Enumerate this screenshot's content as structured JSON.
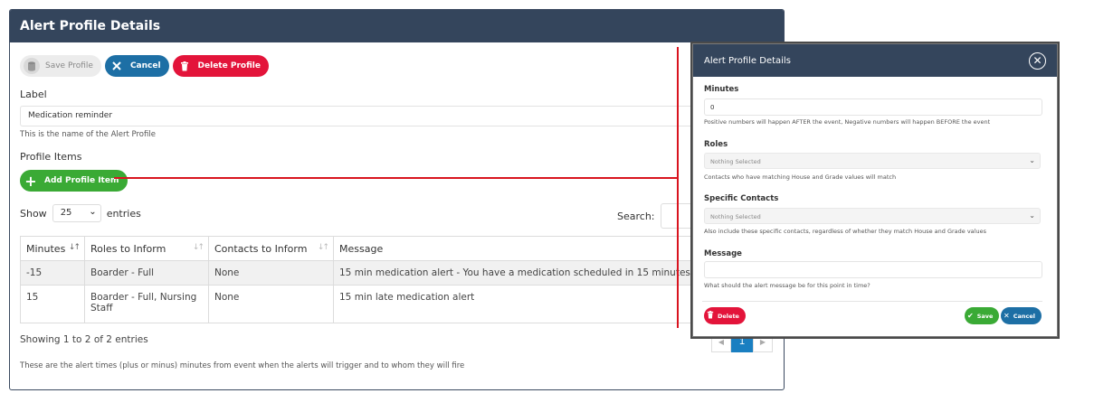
{
  "panel": {
    "title": "Alert Profile Details",
    "toolbar": {
      "save_label": "Save Profile",
      "cancel_label": "Cancel",
      "delete_label": "Delete Profile"
    },
    "label_field": {
      "label": "Label",
      "value": "Medication reminder",
      "hint": "This is the name of the Alert Profile"
    },
    "profile_items": {
      "heading": "Profile Items",
      "add_label": "Add Profile Item"
    },
    "entries": {
      "show": "Show",
      "value": "25",
      "suffix": "entries",
      "search_label": "Search:"
    },
    "table": {
      "headers": [
        "Minutes",
        "Roles to Inform",
        "Contacts to Inform",
        "Message"
      ],
      "rows": [
        [
          "-15",
          "Boarder - Full",
          "None",
          "15 min medication alert - You have a medication scheduled in 15 minutes"
        ],
        [
          "15",
          "Boarder - Full, Nursing Staff",
          "None",
          "15 min late medication alert"
        ]
      ]
    },
    "footer": {
      "info": "Showing 1 to 2 of 2 entries",
      "note": "These are the alert times (plus or minus) minutes from event when the alerts will trigger and to whom they will fire"
    },
    "pagination": {
      "current": "1"
    }
  },
  "modal": {
    "title": "Alert Profile Details",
    "minutes": {
      "label": "Minutes",
      "value": "0",
      "hint": "Positive numbers will happen AFTER the event, Negative numbers will happen BEFORE the event"
    },
    "roles": {
      "label": "Roles",
      "value": "Nothing Selected",
      "hint": "Contacts who have matching House and Grade values will match"
    },
    "contacts": {
      "label": "Specific Contacts",
      "value": "Nothing Selected",
      "hint": "Also include these specific contacts, regardless of whether they match House and Grade values"
    },
    "message": {
      "label": "Message",
      "value": "",
      "hint": "What should the alert message be for this point in time?"
    },
    "buttons": {
      "delete": "Delete",
      "save": "Save",
      "cancel": "Cancel"
    }
  },
  "colors": {
    "header": "#34455c",
    "primary": "#1d6fa5",
    "danger": "#e3143a",
    "success": "#3aaa35",
    "connector": "#d9141f"
  },
  "icons": {
    "save": "database-icon",
    "cancel": "x-icon",
    "delete": "trash-icon",
    "add": "plus-icon",
    "close": "close-icon",
    "check": "check-icon"
  }
}
